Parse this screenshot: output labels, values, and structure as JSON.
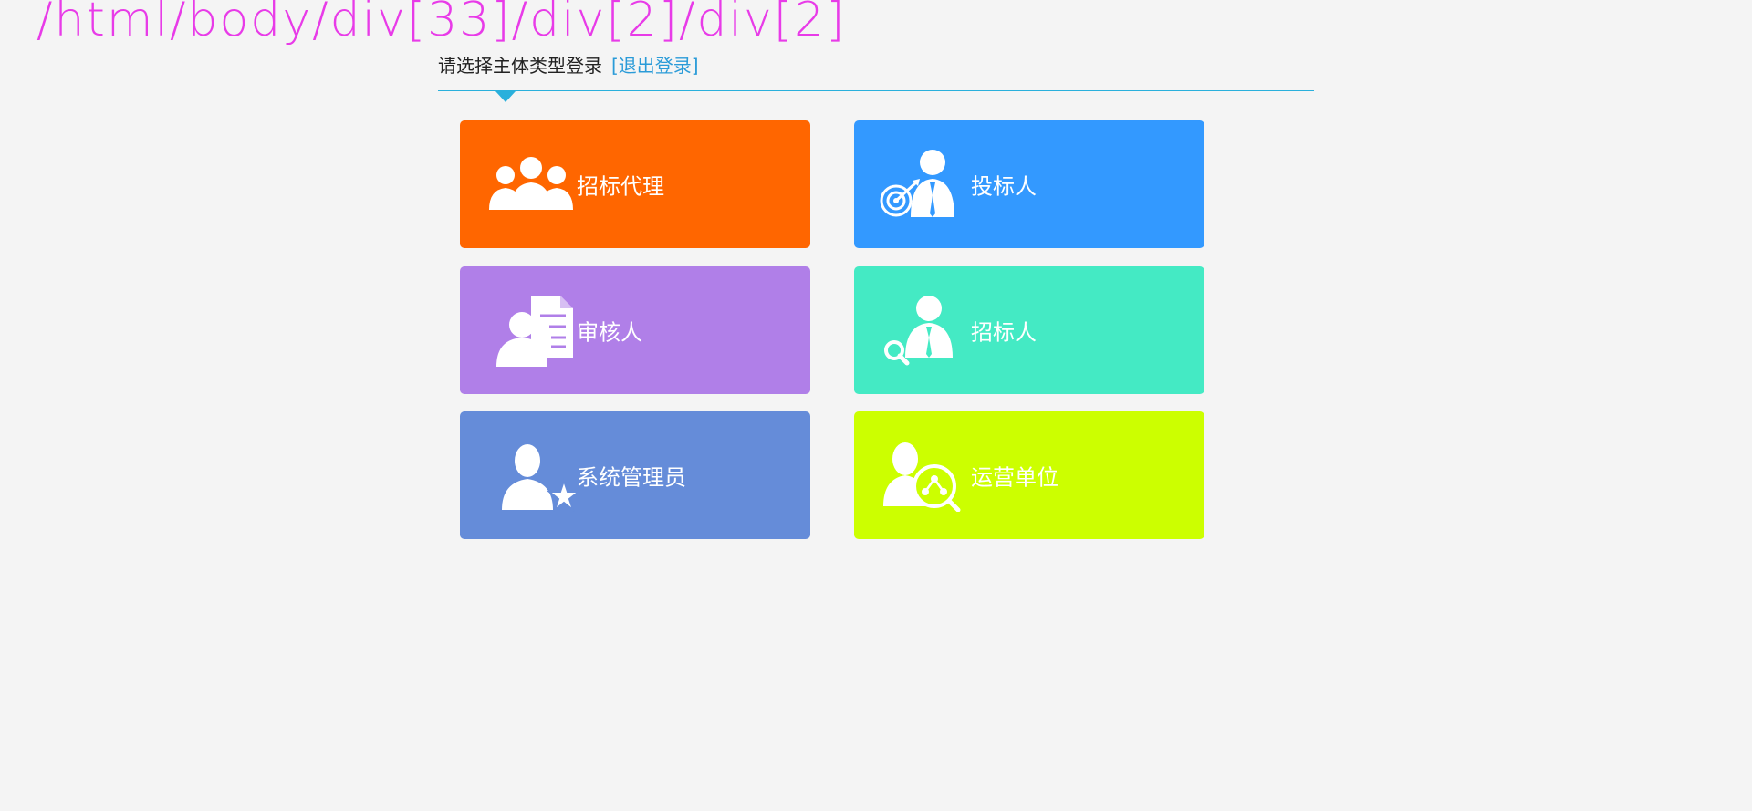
{
  "overlay": {
    "xpath_text": "/html/body/div[33]/div[2]/div[2]"
  },
  "header": {
    "prompt": "请选择主体类型登录",
    "logout_label": "[退出登录]"
  },
  "colors": {
    "accent": "#2ab0dc",
    "logout": "#2a9bd8"
  },
  "cards": [
    {
      "label": "招标代理",
      "color": "#ff6600",
      "icon": "group-people-icon"
    },
    {
      "label": "投标人",
      "color": "#3399ff",
      "icon": "bidder-target-icon"
    },
    {
      "label": "审核人",
      "color": "#b07fe8",
      "icon": "reviewer-document-icon"
    },
    {
      "label": "招标人",
      "color": "#44eac4",
      "icon": "tenderer-search-icon"
    },
    {
      "label": "系统管理员",
      "color": "#658cd9",
      "icon": "admin-star-icon"
    },
    {
      "label": "运营单位",
      "color": "#ccff00",
      "icon": "operator-network-icon"
    }
  ]
}
